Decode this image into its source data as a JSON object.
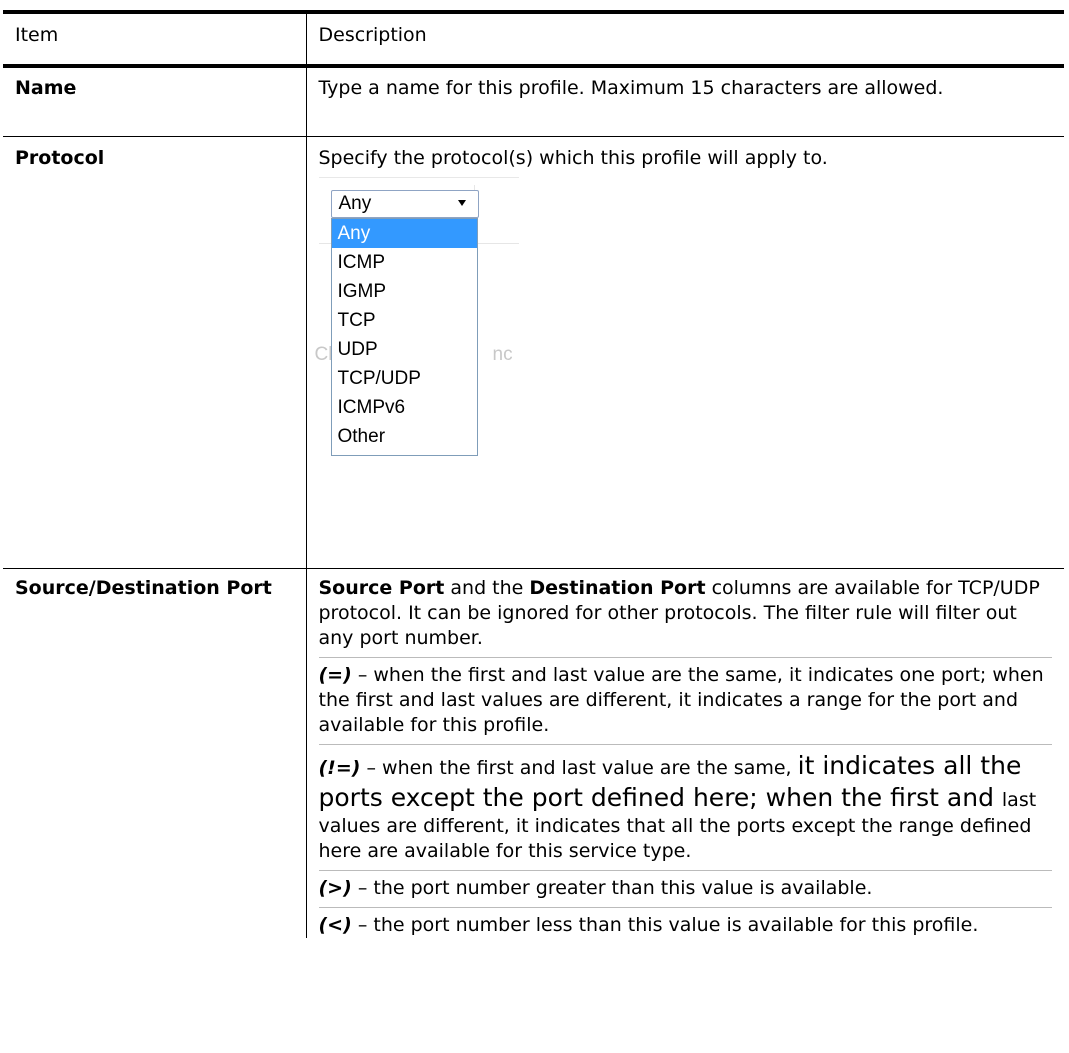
{
  "table": {
    "headers": {
      "item": "Item",
      "description": "Description"
    },
    "rows": {
      "name": {
        "item": "Name",
        "description": "Type a name for this profile. Maximum 15 characters are allowed."
      },
      "protocol": {
        "item": "Protocol",
        "description": "Specify the protocol(s) which this profile will apply to.",
        "dropdown": {
          "selected": "Any",
          "options": [
            "Any",
            "ICMP",
            "IGMP",
            "TCP",
            "UDP",
            "TCP/UDP",
            "ICMPv6",
            "Other"
          ],
          "highlighted": "Any",
          "ghost_left": "Cle",
          "ghost_right": "nc"
        }
      },
      "port": {
        "item": "Source/Destination Port",
        "p1_b1": "Source Port",
        "p1_t1": " and the ",
        "p1_b2": "Destination Port",
        "p1_t2": " columns are available for TCP/UDP protocol. It can be ignored for other protocols. The filter rule will filter out any port number.",
        "p2_op": "(=)",
        "p2_text": " – when the first and last value are the same, it indicates one port; when the first and last values are different, it indicates a range for the port and available for this profile.",
        "p3_op": "(!=)",
        "p3_t1": " – when the first and last value are the same, ",
        "p3_big": "it indicates all the ports except the port defined here; when the first and ",
        "p3_t2": "last values are different, it indicates that all the ports except the range defined here are available for this service type.",
        "p4_op": "(>)",
        "p4_text": " – the port number greater than this value is available.",
        "p5_op": "(<)",
        "p5_text": " – the port number less than this value is available for this profile."
      }
    }
  },
  "colors": {
    "highlight": "#3399ff",
    "border": "#000000",
    "separator": "#bbbbbb"
  }
}
